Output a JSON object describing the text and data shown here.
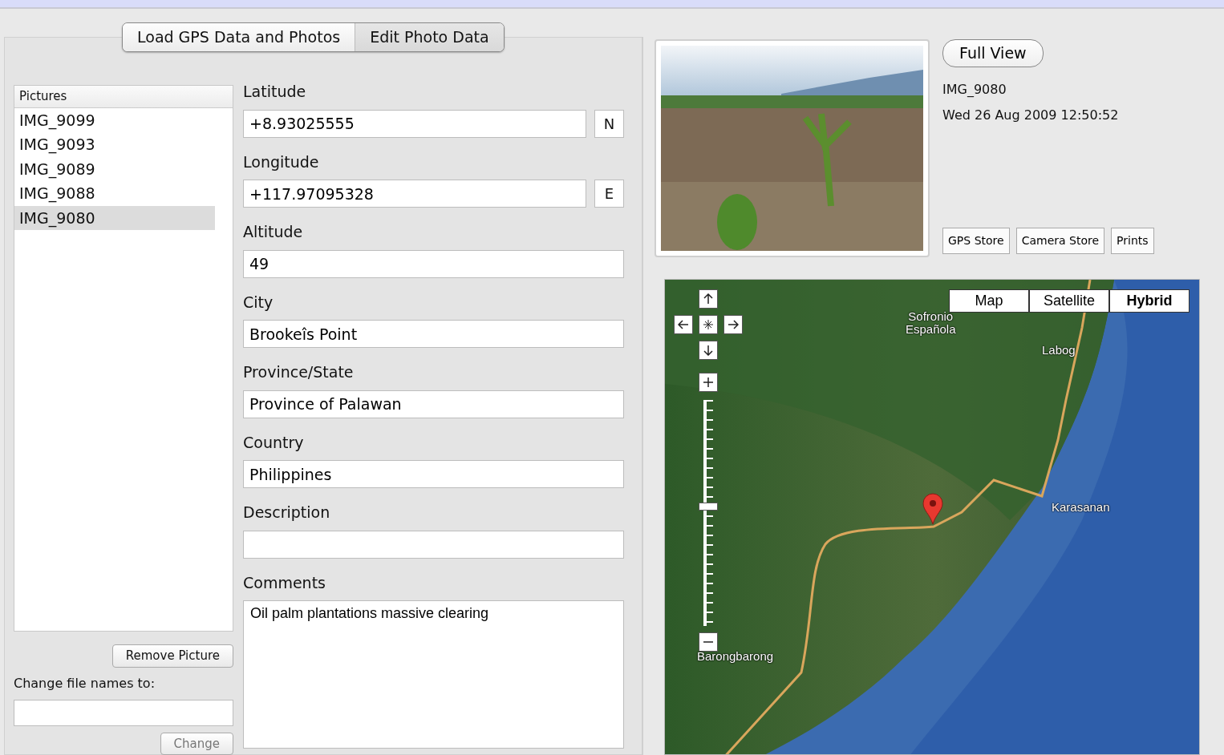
{
  "tabs": [
    {
      "label": "Load GPS Data and Photos",
      "selected": false
    },
    {
      "label": "Edit Photo Data",
      "selected": true
    }
  ],
  "pictures": {
    "header": "Pictures",
    "items": [
      {
        "label": "IMG_9099",
        "selected": false
      },
      {
        "label": "IMG_9093",
        "selected": false
      },
      {
        "label": "IMG_9089",
        "selected": false
      },
      {
        "label": "IMG_9088",
        "selected": false
      },
      {
        "label": "IMG_9080",
        "selected": true
      }
    ]
  },
  "remove_button": "Remove Picture",
  "rename": {
    "label": "Change file names to:",
    "button": "Change"
  },
  "fields": [
    {
      "label": "Latitude",
      "value": "+8.93025555",
      "suffix": "N"
    },
    {
      "label": "Longitude",
      "value": "+117.97095328",
      "suffix": "E"
    },
    {
      "label": "Altitude",
      "value": "49"
    },
    {
      "label": "City",
      "value": "Brookeîs Point"
    },
    {
      "label": "Province/State",
      "value": "Province of Palawan"
    },
    {
      "label": "Country",
      "value": "Philippines"
    },
    {
      "label": "Description"
    }
  ],
  "comments": {
    "label": "Comments",
    "value": "Oil palm plantations massive clearing"
  },
  "photo": {
    "full_view_button": "Full View",
    "name": "IMG_9080",
    "date": "Wed 26 Aug 2009 12:50:52",
    "buttons": [
      "GPS Store",
      "Camera Store",
      "Prints"
    ]
  },
  "map": {
    "types": [
      {
        "label": "Map",
        "selected": false
      },
      {
        "label": "Satellite",
        "selected": false
      },
      {
        "label": "Hybrid",
        "selected": true
      }
    ],
    "zoom": {
      "level": 0.53
    },
    "labels": [
      "Sofronio\nEspañola",
      "Labog",
      "Karasanan",
      "Barongbarong"
    ]
  }
}
